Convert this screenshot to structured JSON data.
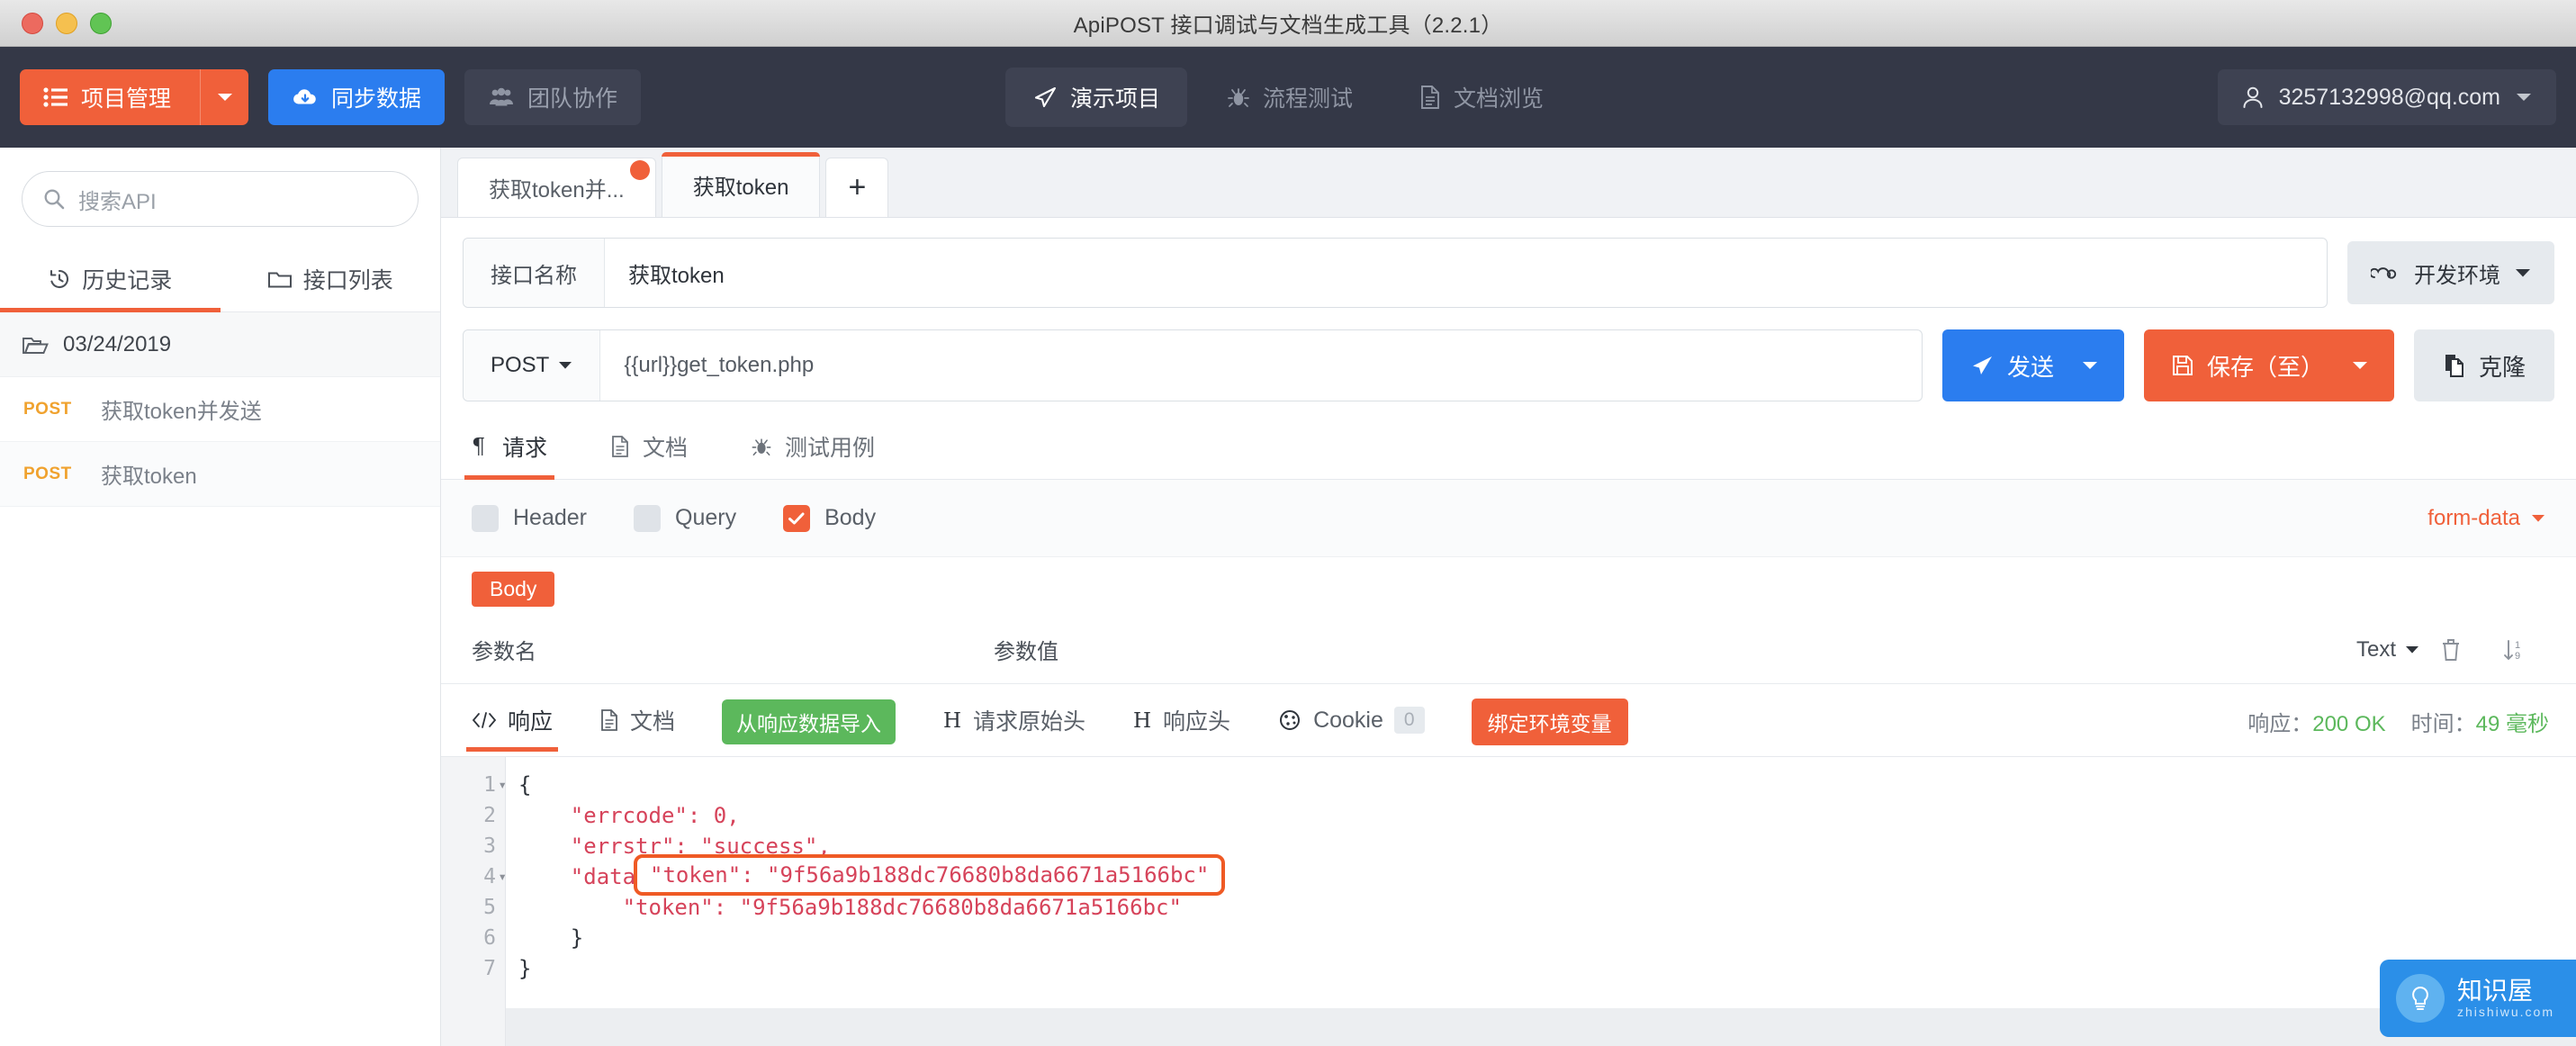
{
  "window": {
    "title": "ApiPOST 接口调试与文档生成工具（2.2.1）"
  },
  "topnav": {
    "project_manage": "项目管理",
    "sync_data": "同步数据",
    "team_collab": "团队协作",
    "center_items": [
      {
        "label": "演示项目",
        "icon": "paper-plane-icon",
        "active": true
      },
      {
        "label": "流程测试",
        "icon": "bug-icon",
        "active": false
      },
      {
        "label": "文档浏览",
        "icon": "document-icon",
        "active": false
      }
    ],
    "user_email": "3257132998@qq.com"
  },
  "sidebar": {
    "search_placeholder": "搜索API",
    "tabs": [
      {
        "label": "历史记录",
        "icon": "history-icon",
        "active": true
      },
      {
        "label": "接口列表",
        "icon": "folder-icon",
        "active": false
      }
    ],
    "folder": "03/24/2019",
    "items": [
      {
        "method": "POST",
        "name": "获取token并发送"
      },
      {
        "method": "POST",
        "name": "获取token"
      }
    ]
  },
  "tabbar": {
    "tabs": [
      {
        "label": "获取token并...",
        "active": false,
        "dirty": true
      },
      {
        "label": "获取token",
        "active": true,
        "dirty": false
      }
    ],
    "add_label": "+"
  },
  "request": {
    "name_label": "接口名称",
    "name_value": "获取token",
    "env_label": "开发环境",
    "method": "POST",
    "url": "{{url}}get_token.php",
    "send_label": "发送",
    "save_label": "保存（至）",
    "clone_label": "克隆",
    "tabs": [
      {
        "label": "请求",
        "icon": "paragraph-icon",
        "active": true
      },
      {
        "label": "文档",
        "icon": "document-icon",
        "active": false
      },
      {
        "label": "测试用例",
        "icon": "bug-icon",
        "active": false
      }
    ],
    "options": [
      {
        "label": "Header",
        "checked": false
      },
      {
        "label": "Query",
        "checked": false
      },
      {
        "label": "Body",
        "checked": true
      }
    ],
    "body_type": "form-data",
    "body_badge": "Body",
    "param_headers": {
      "name": "参数名",
      "value": "参数值",
      "type": "Text"
    }
  },
  "response": {
    "tabs": [
      {
        "label": "响应",
        "icon": "code-icon",
        "active": true
      },
      {
        "label": "文档",
        "icon": "document-icon",
        "active": false
      }
    ],
    "import_btn": "从响应数据导入",
    "raw_header_label": "请求原始头",
    "resp_header_label": "响应头",
    "cookie_label": "Cookie",
    "cookie_count": "0",
    "bind_env_btn": "绑定环境变量",
    "status_label": "响应：",
    "status_value": "200 OK",
    "time_label": "时间：",
    "time_value": "49 毫秒",
    "body_lines": [
      {
        "no": "1",
        "fold": true,
        "text": "{"
      },
      {
        "no": "2",
        "fold": false,
        "text": "    \"errcode\": 0,"
      },
      {
        "no": "3",
        "fold": false,
        "text": "    \"errstr\": \"success\","
      },
      {
        "no": "4",
        "fold": true,
        "text": "    \"data\": {"
      },
      {
        "no": "5",
        "fold": false,
        "text": "        \"token\": \"9f56a9b188dc76680b8da6671a5166bc\""
      },
      {
        "no": "6",
        "fold": false,
        "text": "    }"
      },
      {
        "no": "7",
        "fold": false,
        "text": "}"
      }
    ],
    "highlight_text": "\"token\": \"9f56a9b188dc76680b8da6671a5166bc\""
  },
  "float_widget": {
    "title": "知识屋",
    "subtitle": "zhishiwu.com"
  },
  "colors": {
    "orange": "#f0603a",
    "blue": "#2b7def",
    "dark": "#343847",
    "green": "#5cb85c"
  }
}
